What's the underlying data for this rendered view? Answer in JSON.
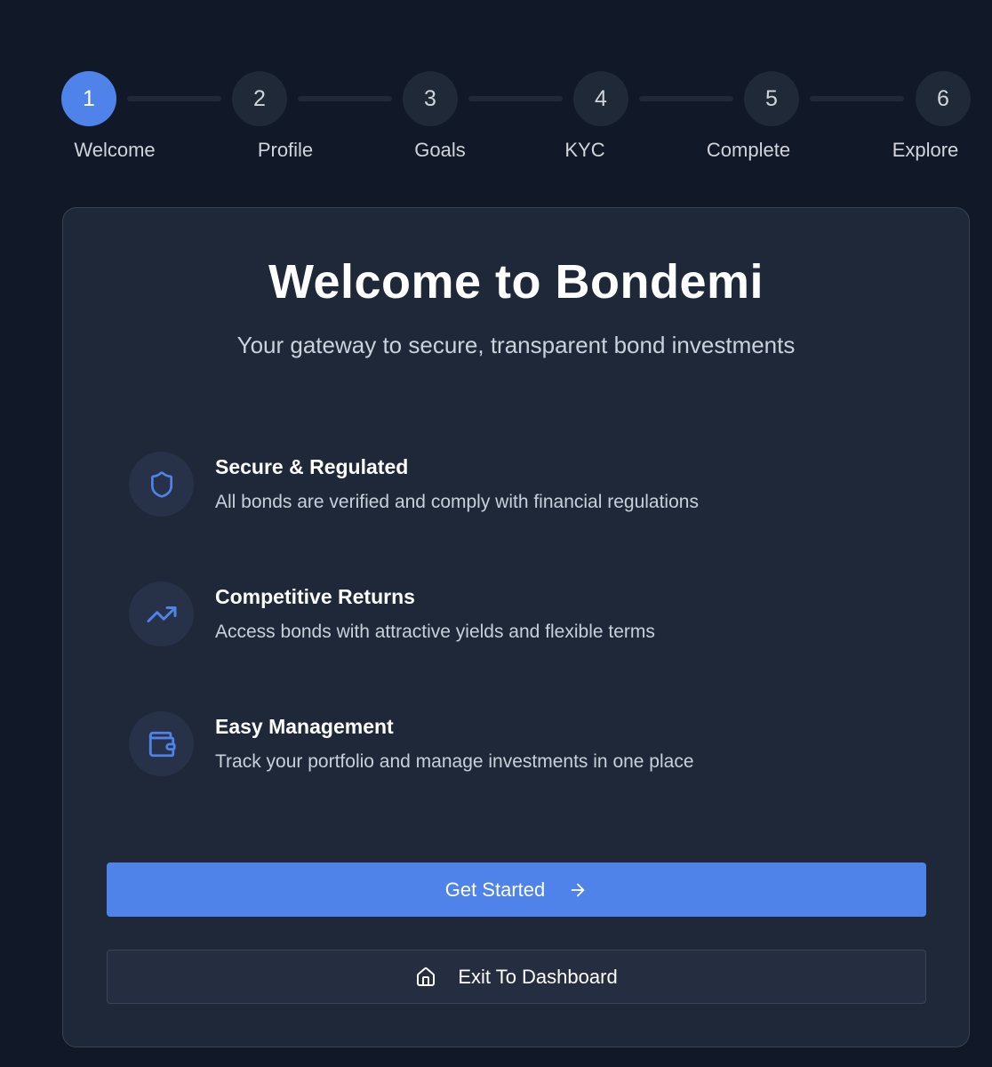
{
  "stepper": {
    "steps": [
      {
        "number": "1",
        "label": "Welcome",
        "active": true
      },
      {
        "number": "2",
        "label": "Profile",
        "active": false
      },
      {
        "number": "3",
        "label": "Goals",
        "active": false
      },
      {
        "number": "4",
        "label": "KYC",
        "active": false
      },
      {
        "number": "5",
        "label": "Complete",
        "active": false
      },
      {
        "number": "6",
        "label": "Explore",
        "active": false
      }
    ]
  },
  "card": {
    "title": "Welcome to Bondemi",
    "subtitle": "Your gateway to secure, transparent bond investments",
    "features": [
      {
        "icon": "shield-icon",
        "title": "Secure & Regulated",
        "description": "All bonds are verified and comply with financial regulations"
      },
      {
        "icon": "trending-up-icon",
        "title": "Competitive Returns",
        "description": "Access bonds with attractive yields and flexible terms"
      },
      {
        "icon": "wallet-icon",
        "title": "Easy Management",
        "description": "Track your portfolio and manage investments in one place"
      }
    ],
    "primary_button": {
      "label": "Get Started",
      "icon": "arrow-right-icon"
    },
    "secondary_button": {
      "label": "Exit To Dashboard",
      "icon": "home-icon"
    }
  },
  "colors": {
    "background": "#111827",
    "card": "#1f2839",
    "accent": "#4f83ea",
    "step_inactive": "#1f2937"
  }
}
